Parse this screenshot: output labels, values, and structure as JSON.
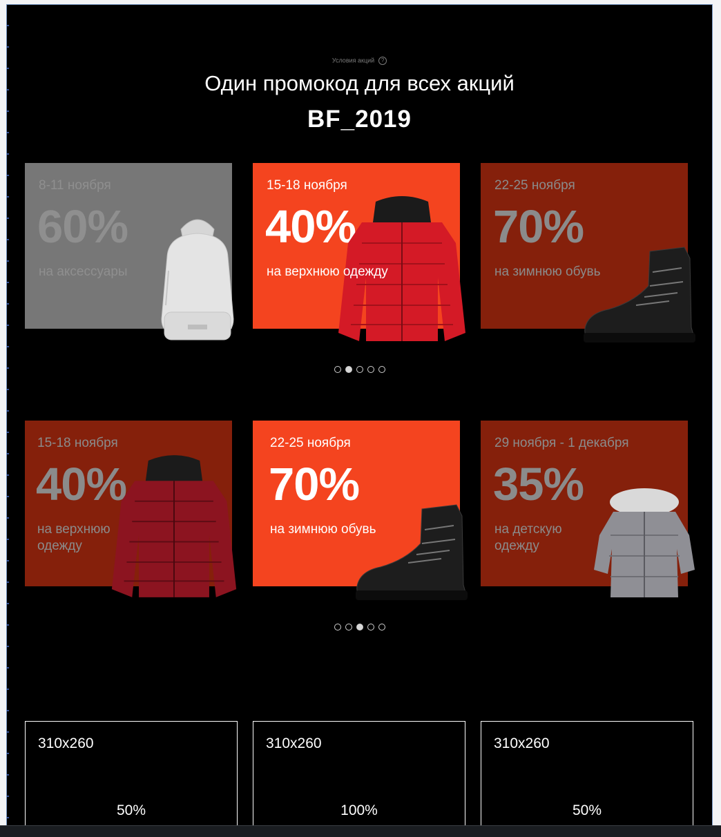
{
  "promo": {
    "terms_label": "Условия акций",
    "help_glyph": "?",
    "headline": "Один промокод для всех акций",
    "code": "BF_2019"
  },
  "carousels": [
    {
      "cards": [
        {
          "date": "8-11 ноября",
          "discount": "60%",
          "category": "на аксессуары",
          "product_icon": "backpack-icon",
          "state": "inactive"
        },
        {
          "date": "15-18 ноября",
          "discount": "40%",
          "category": "на верхнюю одежду",
          "product_icon": "jacket-icon",
          "state": "active"
        },
        {
          "date": "22-25 ноября",
          "discount": "70%",
          "category": "на зимнюю обувь",
          "product_icon": "boot-icon",
          "state": "upcoming"
        }
      ],
      "dots": {
        "count": 5,
        "active": 2
      }
    },
    {
      "cards": [
        {
          "date": "15-18 ноября",
          "discount": "40%",
          "category": "на верхнюю\nодежду",
          "product_icon": "jacket-icon",
          "state": "upcoming"
        },
        {
          "date": "22-25 ноября",
          "discount": "70%",
          "category": "на зимнюю обувь",
          "product_icon": "boot-icon",
          "state": "active"
        },
        {
          "date": "29 ноября - 1 декабря",
          "discount": "35%",
          "category": "на детскую\nодежду",
          "product_icon": "kids-coat-icon",
          "state": "upcoming"
        }
      ],
      "dots": {
        "count": 5,
        "active": 3
      }
    }
  ],
  "placeholders": [
    {
      "size": "310x260",
      "percent": "50%"
    },
    {
      "size": "310x260",
      "percent": "100%"
    },
    {
      "size": "310x260",
      "percent": "50%"
    }
  ],
  "colors": {
    "background": "#000000",
    "accent_orange": "#f4441f",
    "dark_red": "#85200b",
    "inactive_gray": "#777777",
    "text_white": "#ffffff"
  }
}
